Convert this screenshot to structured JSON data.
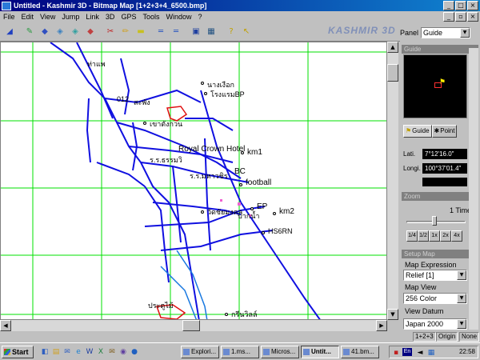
{
  "window": {
    "title": "Untitled - Kashmir 3D - Bitmap Map [1+2+3+4_6500.bmp]"
  },
  "menu": [
    "File",
    "Edit",
    "View",
    "Jump",
    "Link",
    "3D",
    "GPS",
    "Tools",
    "Window",
    "?"
  ],
  "brand": "KASHMIR 3D",
  "toolbar": {
    "tools": [
      "tilt-left-icon",
      "pen-icon",
      "move-icon",
      "layer-icon",
      "layer2-icon",
      "color-icon",
      "cut-icon",
      "edit-icon",
      "ruler-icon",
      "line1-icon",
      "line2-icon",
      "map-icon",
      "grid-icon",
      "help-icon",
      "pointer-icon"
    ]
  },
  "map": {
    "labels": [
      "ท่าแพ",
      "นางเงือก",
      "โรงแรมBP",
      "012",
      "สะพัง",
      "เขาตังกวน",
      "Royal Crown Hotel",
      "km1",
      "ร.ร.ธรรมวิ",
      "ร.ร.มหาวชิร",
      "BC",
      "football",
      "วัดชัยมงคล",
      "EP",
      "km2",
      "HS6RN",
      "ปากน้ำ",
      "ประตูไม้",
      "กรีนวิลล์"
    ]
  },
  "side": {
    "panel_label": "Panel",
    "panel_value": "Guide",
    "guide_title": "Guide",
    "tab_guide": "Guide",
    "tab_point": "Point",
    "lat_label": "Lati.",
    "lat_value": "7°12'16.0\"",
    "lon_label": "Longi.",
    "lon_value": "100°37'01.4\"",
    "zoom_title": "Zoom",
    "zoom_value": "1 Times",
    "zoom_buttons": [
      "1/4",
      "1/2",
      "1x",
      "2x",
      "4x"
    ],
    "setup_title": "Setup Map",
    "map_expression_label": "Map Expression",
    "map_expression_value": "Relief [1]",
    "map_view_label": "Map View",
    "map_view_value": "256 Color",
    "view_datum_label": "View Datum",
    "view_datum_value": "Japan 2000"
  },
  "status": {
    "cell1": "1+2+3",
    "cell2": "Origin",
    "cell3": "None"
  },
  "taskbar": {
    "start": "Start",
    "tasks": [
      "Explori...",
      "1.ms...",
      "Micros...",
      "Untit...",
      "41.bm..."
    ],
    "time": "22:58",
    "lang": "En"
  }
}
